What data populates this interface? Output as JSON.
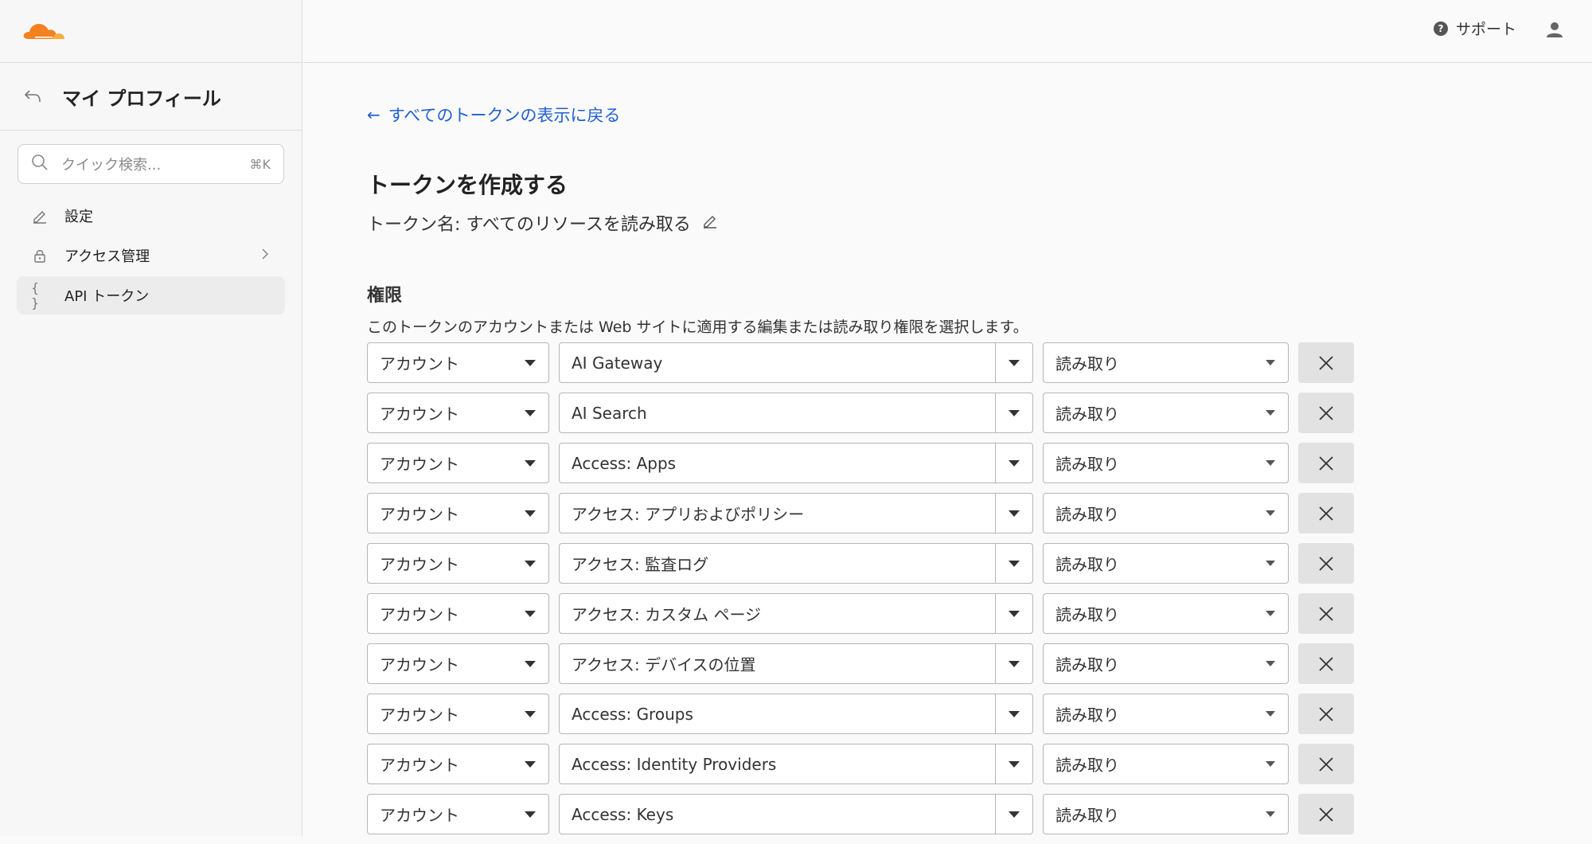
{
  "colors": {
    "accent": "#1f5fd1",
    "brand": "#f48120"
  },
  "sidebar": {
    "logo": "cloudflare-logo",
    "header_title": "マイ プロフィール",
    "search_placeholder": "クイック検索...",
    "search_shortcut": "⌘K",
    "items": [
      {
        "label": "設定",
        "icon": "pencil-icon"
      },
      {
        "label": "アクセス管理",
        "icon": "lock-icon"
      },
      {
        "label": "API トークン",
        "icon": "braces-icon"
      }
    ]
  },
  "header": {
    "support_label": "サポート"
  },
  "main": {
    "back_link": "すべてのトークンの表示に戻る",
    "title": "トークンを作成する",
    "token_name": "トークン名: すべてのリソースを読み取る",
    "permissions_title": "権限",
    "permissions_desc": "このトークンのアカウントまたは Web サイトに適用する編集または読み取り権限を選択します。",
    "rows": [
      {
        "scope": "アカウント",
        "resource": "AI Gateway",
        "permission": "読み取り"
      },
      {
        "scope": "アカウント",
        "resource": "AI Search",
        "permission": "読み取り"
      },
      {
        "scope": "アカウント",
        "resource": "Access: Apps",
        "permission": "読み取り"
      },
      {
        "scope": "アカウント",
        "resource": "アクセス: アプリおよびポリシー",
        "permission": "読み取り"
      },
      {
        "scope": "アカウント",
        "resource": "アクセス: 監査ログ",
        "permission": "読み取り"
      },
      {
        "scope": "アカウント",
        "resource": "アクセス: カスタム ページ",
        "permission": "読み取り"
      },
      {
        "scope": "アカウント",
        "resource": "アクセス: デバイスの位置",
        "permission": "読み取り"
      },
      {
        "scope": "アカウント",
        "resource": "Access: Groups",
        "permission": "読み取り"
      },
      {
        "scope": "アカウント",
        "resource": "Access: Identity Providers",
        "permission": "読み取り"
      },
      {
        "scope": "アカウント",
        "resource": "Access: Keys",
        "permission": "読み取り"
      }
    ]
  }
}
